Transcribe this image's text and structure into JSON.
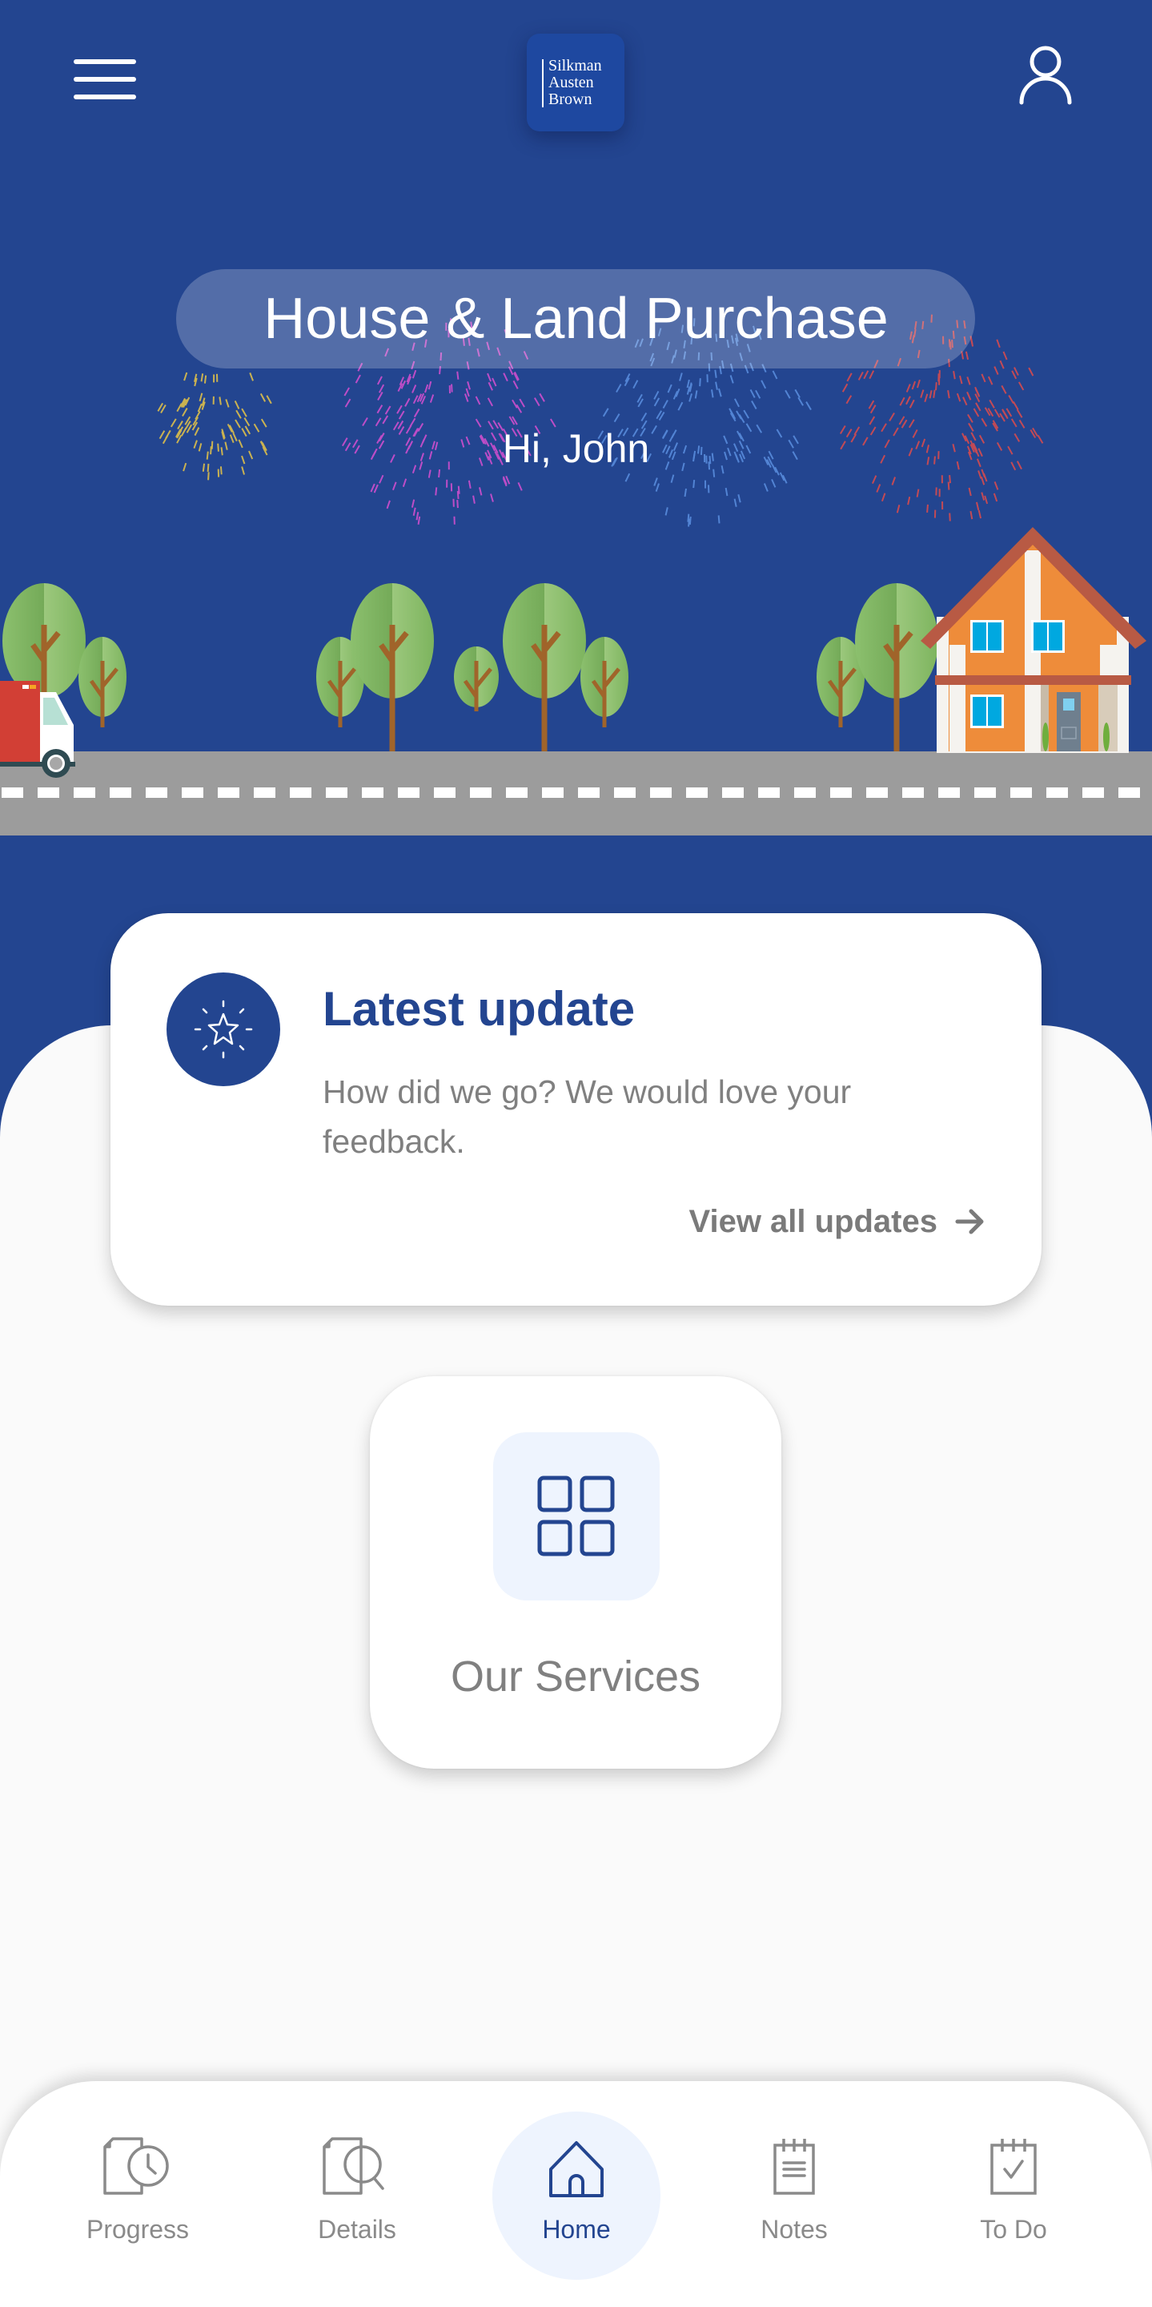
{
  "header": {
    "menu_icon": "hamburger-menu-icon",
    "logo_lines": [
      "Silkman",
      "Austen",
      "Brown"
    ],
    "profile_icon": "user-profile-icon"
  },
  "hero": {
    "title": "House & Land Purchase",
    "greeting": "Hi, John",
    "illustration": {
      "elements": [
        "fireworks",
        "trees",
        "delivery-truck",
        "house",
        "road"
      ],
      "firework_colors": [
        "#e8c547",
        "#d94fd1",
        "#5b8fe0",
        "#e04b4b"
      ]
    }
  },
  "latest_update": {
    "icon": "star-sparkle-icon",
    "title": "Latest update",
    "body": "How did we go? We would love your feedback.",
    "link_label": "View all updates",
    "link_icon": "arrow-right-icon"
  },
  "services": {
    "icon": "grid-icon",
    "label": "Our Services"
  },
  "bottom_nav": {
    "items": [
      {
        "label": "Progress",
        "icon": "document-clock-icon",
        "active": false
      },
      {
        "label": "Details",
        "icon": "document-search-icon",
        "active": false
      },
      {
        "label": "Home",
        "icon": "home-icon",
        "active": true
      },
      {
        "label": "Notes",
        "icon": "notepad-icon",
        "active": false
      },
      {
        "label": "To Do",
        "icon": "checklist-icon",
        "active": false
      }
    ]
  },
  "colors": {
    "brand_blue": "#234590",
    "text_gray": "#808080",
    "icon_gray": "#8a8a8a",
    "active_bg": "#eef4fe",
    "background": "#fafafa"
  }
}
